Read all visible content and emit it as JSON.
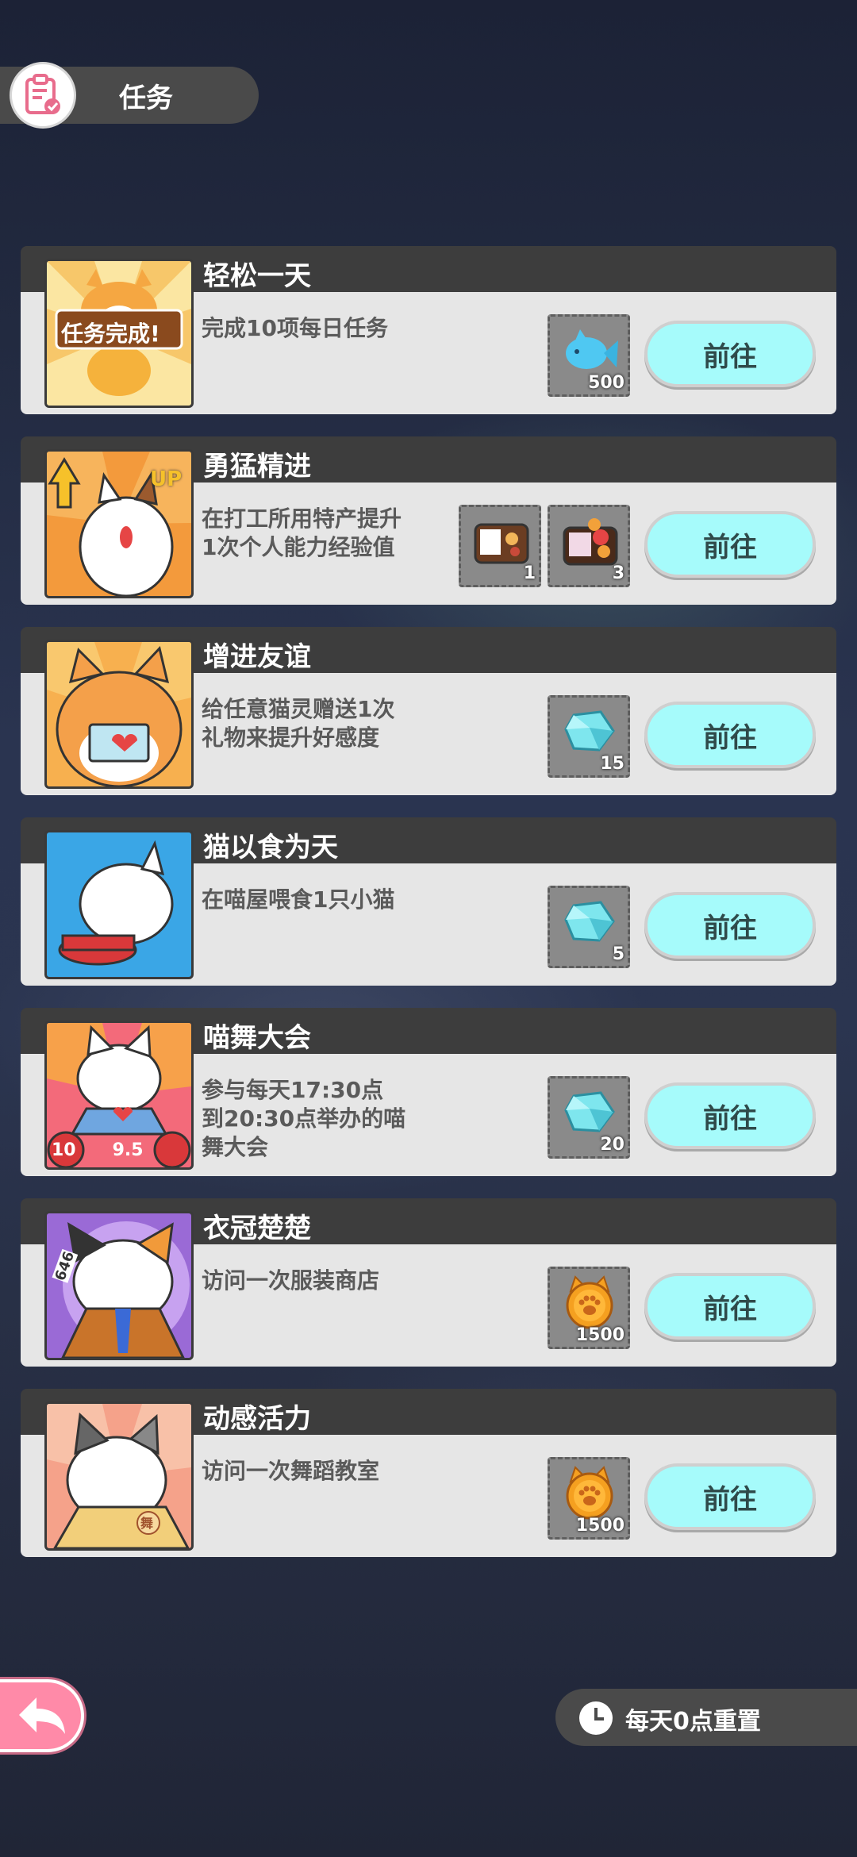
{
  "header": {
    "title": "任务",
    "icon": "clipboard-icon"
  },
  "tasks": [
    {
      "title": "轻松一天",
      "desc": "完成10项每日任务",
      "thumb_text": "任务完成!",
      "rewards": [
        {
          "icon": "blue-fish-icon",
          "count": "500"
        }
      ],
      "button": "前往"
    },
    {
      "title": "勇猛精进",
      "desc": "在打工所用特产提升\n1次个人能力经验值",
      "thumb_text": "UP",
      "rewards": [
        {
          "icon": "bento-box-icon",
          "count": "1"
        },
        {
          "icon": "food-box-icon",
          "count": "3"
        }
      ],
      "button": "前往"
    },
    {
      "title": "增进友谊",
      "desc": "给任意猫灵赠送1次\n礼物来提升好感度",
      "rewards": [
        {
          "icon": "crystal-icon",
          "count": "15"
        }
      ],
      "button": "前往"
    },
    {
      "title": "猫以食为天",
      "desc": "在喵屋喂食1只小猫",
      "rewards": [
        {
          "icon": "crystal-icon",
          "count": "5"
        }
      ],
      "button": "前往"
    },
    {
      "title": "喵舞大会",
      "desc": "参与每天17:30点\n到20:30点举办的喵\n舞大会",
      "thumb_text": "10      9.5",
      "rewards": [
        {
          "icon": "crystal-icon",
          "count": "20"
        }
      ],
      "button": "前往"
    },
    {
      "title": "衣冠楚楚",
      "desc": "访问一次服装商店",
      "thumb_text": "646",
      "rewards": [
        {
          "icon": "paw-coin-icon",
          "count": "1500"
        }
      ],
      "button": "前往"
    },
    {
      "title": "动感活力",
      "desc": "访问一次舞蹈教室",
      "thumb_text": "舞",
      "rewards": [
        {
          "icon": "paw-coin-icon",
          "count": "1500"
        }
      ],
      "button": "前往"
    }
  ],
  "footer": {
    "back_icon": "back-arrow-icon",
    "reset_icon": "clock-icon",
    "reset_text": "每天0点重置"
  },
  "colors": {
    "button": "#a6fbfb",
    "card_head": "#3d3d3d",
    "card_body": "#e6e6e6",
    "back": "#ff8aa8"
  }
}
